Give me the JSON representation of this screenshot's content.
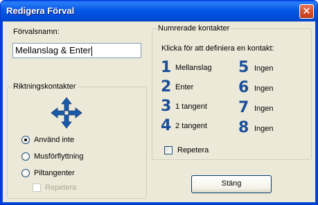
{
  "window": {
    "title": "Redigera Förval",
    "close_glyph": "✕"
  },
  "preset_name": {
    "label": "Förvalsnamn:",
    "value": "Mellanslag & Enter"
  },
  "direction_group": {
    "legend": "Riktningskontakter",
    "icon": "four-way-arrow-icon",
    "options": [
      {
        "label": "Använd inte",
        "checked": true
      },
      {
        "label": "Musförflyttning",
        "checked": false
      },
      {
        "label": "Piltangenter",
        "checked": false
      }
    ],
    "repeat_label": "Repetera",
    "repeat_disabled": true
  },
  "numbered_group": {
    "legend": "Numrerade kontakter",
    "instruction": "Klicka för att definiera en kontakt:",
    "contacts": [
      {
        "number": "1",
        "label": "Mellanslag"
      },
      {
        "number": "2",
        "label": "Enter"
      },
      {
        "number": "3",
        "label": "1 tangent"
      },
      {
        "number": "4",
        "label": "2 tangent"
      },
      {
        "number": "5",
        "label": "Ingen"
      },
      {
        "number": "6",
        "label": "Ingen"
      },
      {
        "number": "7",
        "label": "Ingen"
      },
      {
        "number": "8",
        "label": "Ingen"
      }
    ],
    "repeat_label": "Repetera"
  },
  "close_button": {
    "label": "Stäng"
  },
  "colors": {
    "titlebar": "#0250dc",
    "dialog_bg": "#ece9d8",
    "number_color": "#1b4f99"
  }
}
